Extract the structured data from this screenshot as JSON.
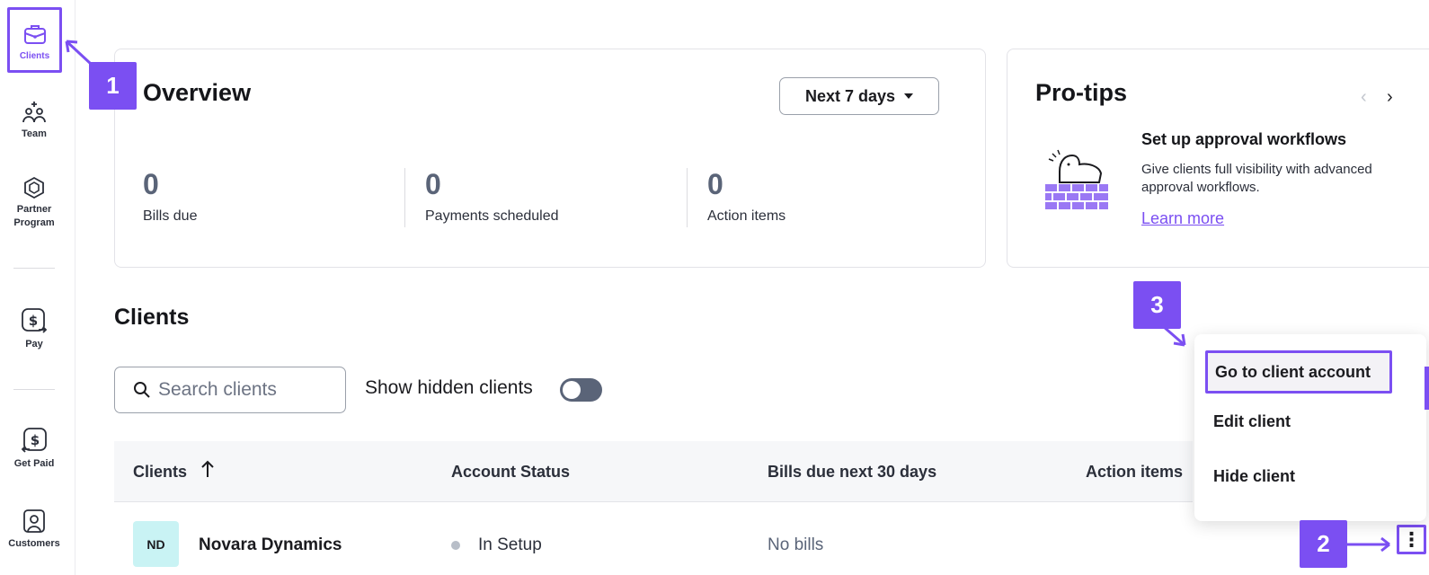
{
  "sidebar": {
    "items": [
      {
        "label": "Clients"
      },
      {
        "label": "Team"
      },
      {
        "label": "Partner Program"
      },
      {
        "label": "Pay"
      },
      {
        "label": "Get Paid"
      },
      {
        "label": "Customers"
      }
    ]
  },
  "overview": {
    "title": "Overview",
    "range_label": "Next 7 days",
    "stats": [
      {
        "value": "0",
        "label": "Bills due"
      },
      {
        "value": "0",
        "label": "Payments scheduled"
      },
      {
        "value": "0",
        "label": "Action items"
      }
    ]
  },
  "protips": {
    "title": "Pro-tips",
    "tip_title": "Set up approval workflows",
    "tip_body": "Give clients full visibility with advanced approval workflows.",
    "link_label": "Learn more"
  },
  "clients": {
    "title": "Clients",
    "search_placeholder": "Search clients",
    "toggle_label": "Show hidden clients",
    "columns": [
      "Clients",
      "Account Status",
      "Bills due next 30 days",
      "Action items"
    ],
    "rows": [
      {
        "initials": "ND",
        "name": "Novara Dynamics",
        "status": "In Setup",
        "bills": "No bills"
      }
    ]
  },
  "menu": {
    "items": [
      "Go to client account",
      "Edit client",
      "Hide client"
    ]
  },
  "callouts": [
    "1",
    "2",
    "3"
  ],
  "colors": {
    "accent": "#7b4ff2",
    "avatar_bg": "#c9f3f4"
  }
}
